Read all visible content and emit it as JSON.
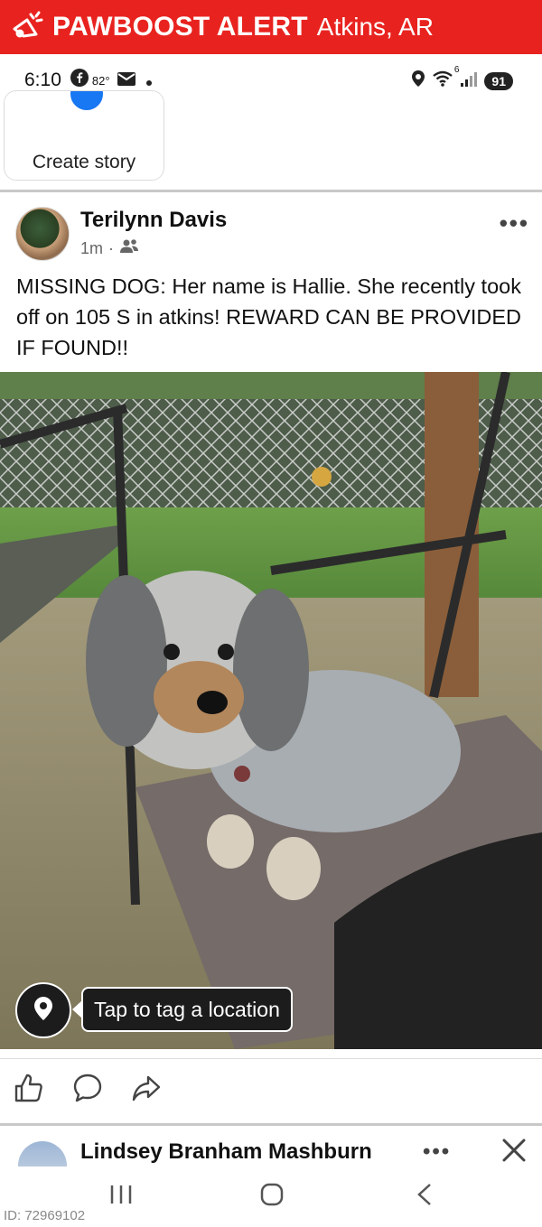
{
  "banner": {
    "brand": "PAWBOOST ALERT",
    "location": "Atkins, AR",
    "color": "#e8231f"
  },
  "status_bar": {
    "time": "6:10",
    "temperature": "82°",
    "wifi_label": "6",
    "battery": "91",
    "icons": [
      "facebook-icon",
      "mail-icon",
      "dot-icon",
      "location-icon",
      "wifi-icon",
      "signal-icon",
      "battery-icon"
    ]
  },
  "stories": {
    "create_label": "Create story"
  },
  "post": {
    "author": "Terilynn Davis",
    "time_ago": "1m",
    "separator": "·",
    "privacy_icon": "friends-icon",
    "text": "MISSING DOG: Her name is Hallie. She recently took off on 105 S in atkins! REWARD CAN BE PROVIDED IF FOUND!!",
    "photo_icon": "dog-photo",
    "tag_location_label": "Tap to tag a location"
  },
  "actions": {
    "icons": [
      "like-icon",
      "comment-icon",
      "share-icon"
    ]
  },
  "next_comment": {
    "author": "Lindsey Branham Mashburn"
  },
  "navigation": {
    "icons": [
      "recent-apps-icon",
      "home-icon",
      "back-icon"
    ]
  },
  "footer": {
    "id": "ID: 72969102"
  }
}
